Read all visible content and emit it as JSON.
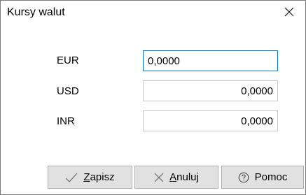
{
  "window": {
    "title": "Kursy walut"
  },
  "rates": [
    {
      "label": "EUR",
      "value": "0,0000"
    },
    {
      "label": "USD",
      "value": "0,0000"
    },
    {
      "label": "INR",
      "value": "0,0000"
    }
  ],
  "buttons": {
    "save": {
      "mnemonic": "Z",
      "rest": "apisz",
      "icon": "check-icon"
    },
    "cancel": {
      "mnemonic": "A",
      "rest": "nuluj",
      "icon": "x-icon"
    },
    "help": {
      "label": "Pomoc",
      "icon": "question-circle-icon"
    }
  },
  "colors": {
    "focus_border": "#0078d7",
    "button_bg": "#e1e1e1",
    "button_border": "#adadad",
    "icon_gray": "#6d6d6d"
  }
}
